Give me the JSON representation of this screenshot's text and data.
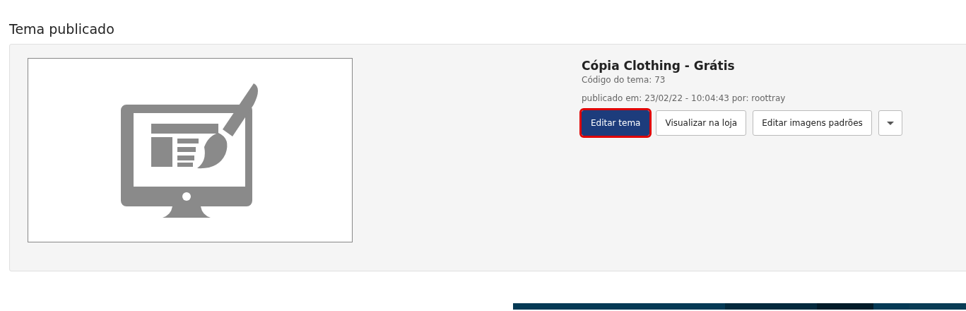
{
  "section_title": "Tema publicado",
  "theme": {
    "thumbnail": {
      "kind": "icon"
    },
    "name": "Cópia Clothing - Grátis",
    "code": "Código do tema: 73",
    "published": "publicado em: 23/02/22 - 10:04:43 por: roottray",
    "buttons": [
      {
        "label": "Editar tema",
        "kind": "primary",
        "highlighted": true
      },
      {
        "label": "Visualizar na loja",
        "kind": "default",
        "highlighted": false
      },
      {
        "label": "Editar imagens padrões",
        "kind": "default",
        "highlighted": false
      },
      {
        "kind": "dropdown",
        "highlighted": false
      }
    ]
  }
}
